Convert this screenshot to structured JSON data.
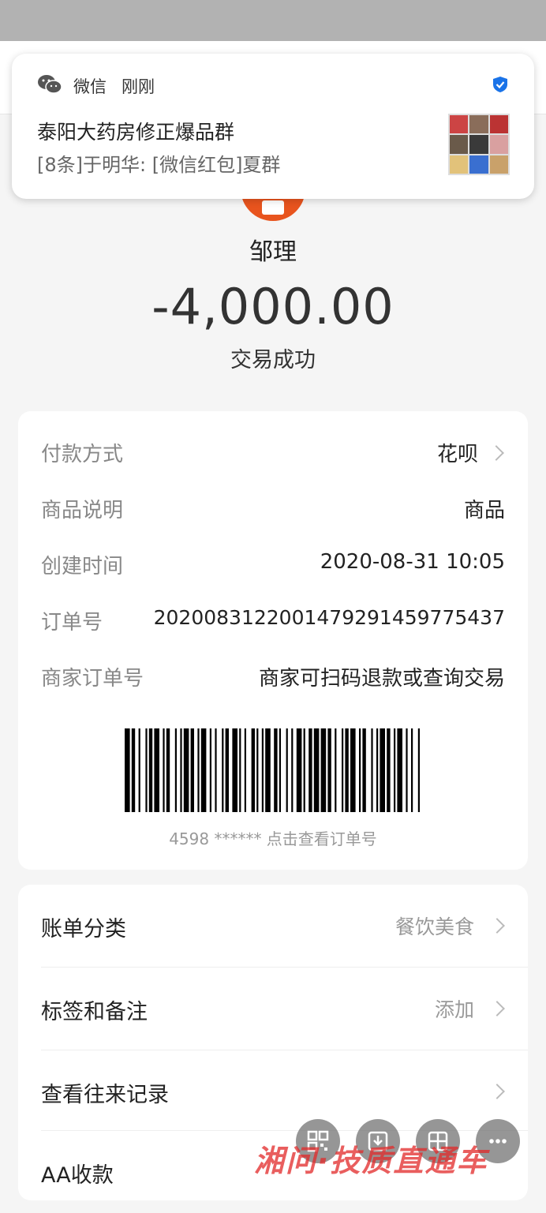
{
  "notification": {
    "app_name": "微信",
    "time": "刚刚",
    "title": "泰阳大药房修正爆品群",
    "body": "[8条]于明华: [微信红包]夏群"
  },
  "transaction": {
    "merchant": "邹理",
    "amount": "-4,000.00",
    "status": "交易成功"
  },
  "details": {
    "payment_method_label": "付款方式",
    "payment_method_value": "花呗",
    "product_label": "商品说明",
    "product_value": "商品",
    "created_label": "创建时间",
    "created_value": "2020-08-31 10:05",
    "order_label": "订单号",
    "order_value": "2020083122001479291459775437",
    "merchant_order_label": "商家订单号",
    "merchant_order_value": "商家可扫码退款或查询交易",
    "barcode_caption": "4598 ****** 点击查看订单号"
  },
  "actions": {
    "category_label": "账单分类",
    "category_value": "餐饮美食",
    "tags_label": "标签和备注",
    "tags_value": "添加",
    "history_label": "查看往来记录",
    "aa_label": "AA收款"
  },
  "floating_buttons": [
    "qr-code-icon",
    "download-icon",
    "grid-icon",
    "more-icon"
  ],
  "watermark": "湘问·技质直通车",
  "colors": {
    "merchant_logo": "#e8541e",
    "verified_badge": "#1a73e8",
    "watermark": "#e12828"
  }
}
